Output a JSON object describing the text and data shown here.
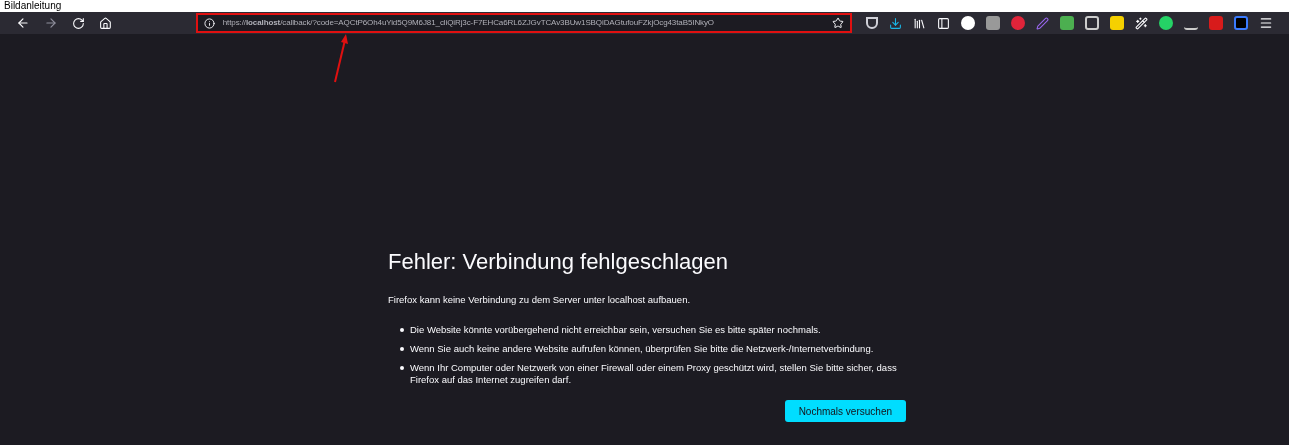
{
  "caption": "Bildanleitung",
  "toolbar": {
    "url": "https://**localhost**/callback/?code=AQCtP6Oh4uYid5Q9M6J81_cliQiRj3c-F7EHCa6RL6ZJGvTCAv3BUw1SBQiDAGtufouFZkjOcg43taB5INkyO"
  },
  "error_page": {
    "title": "Fehler: Verbindung fehlgeschlagen",
    "message": "Firefox kann keine Verbindung zu dem Server unter localhost aufbauen.",
    "tips": [
      "Die Website könnte vorübergehend nicht erreichbar sein, versuchen Sie es bitte später nochmals.",
      "Wenn Sie auch keine andere Website aufrufen können, überprüfen Sie bitte die Netzwerk-/Internetverbindung.",
      "Wenn Ihr Computer oder Netzwerk von einer Firewall oder einem Proxy geschützt wird, stellen Sie bitte sicher, dass Firefox auf das Internet zugreifen darf."
    ],
    "retry_button": "Nochmals versuchen"
  }
}
